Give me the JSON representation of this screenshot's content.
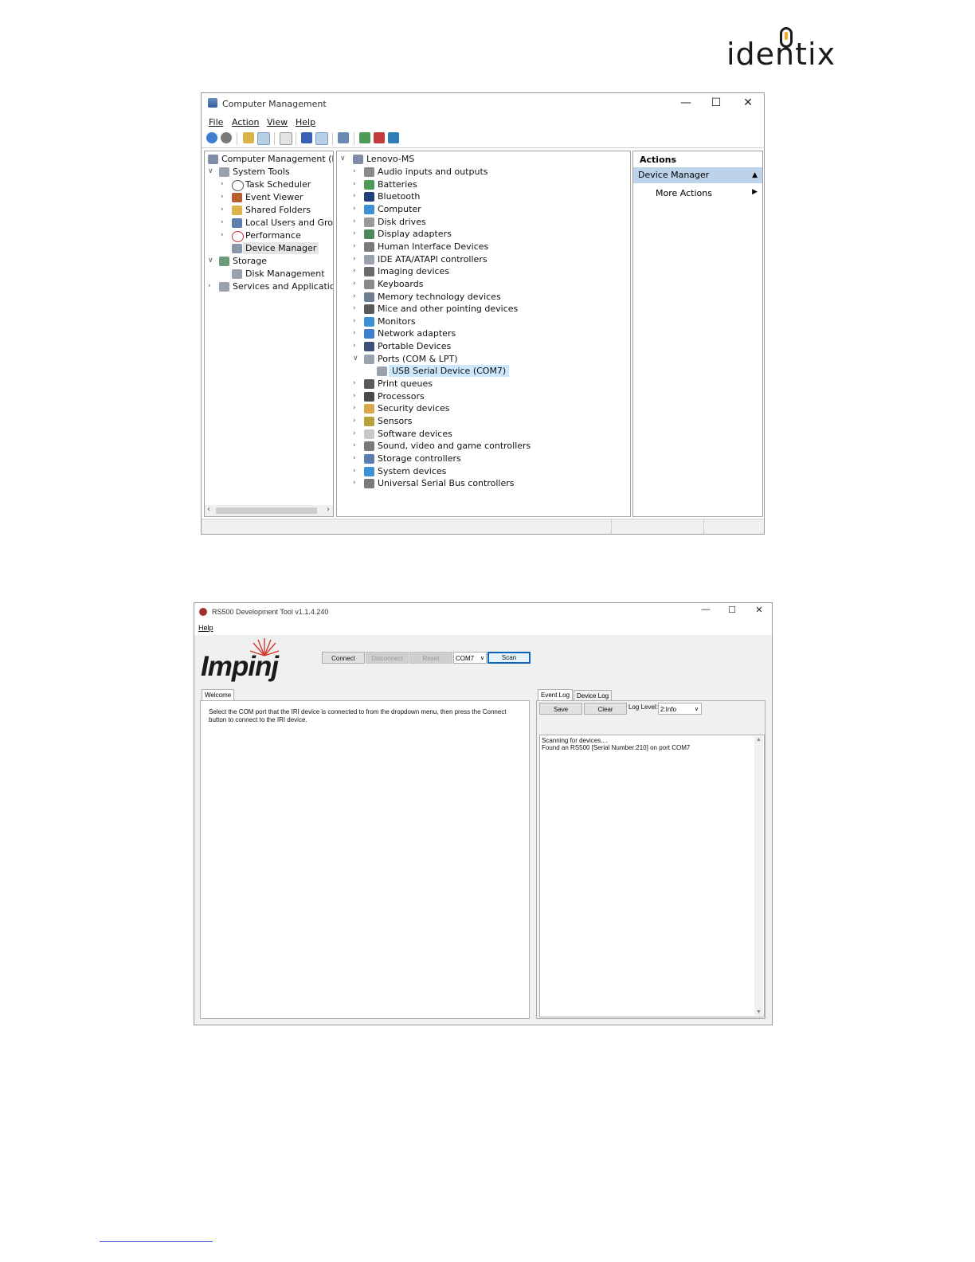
{
  "brand": {
    "logo_text": "identix"
  },
  "computer_management": {
    "title": "Computer Management",
    "window_controls": {
      "minimize": "—",
      "maximize": "☐",
      "close": "✕"
    },
    "menu": [
      "File",
      "Action",
      "View",
      "Help"
    ],
    "left_tree": [
      {
        "label": "Computer Management (Local",
        "level": 0,
        "chevron": ""
      },
      {
        "label": "System Tools",
        "level": 1,
        "chevron": "v"
      },
      {
        "label": "Task Scheduler",
        "level": 2,
        "chevron": ">"
      },
      {
        "label": "Event Viewer",
        "level": 2,
        "chevron": ">"
      },
      {
        "label": "Shared Folders",
        "level": 2,
        "chevron": ">"
      },
      {
        "label": "Local Users and Groups",
        "level": 2,
        "chevron": ">"
      },
      {
        "label": "Performance",
        "level": 2,
        "chevron": ">"
      },
      {
        "label": "Device Manager",
        "level": 2,
        "chevron": "",
        "selected": true
      },
      {
        "label": "Storage",
        "level": 1,
        "chevron": "v"
      },
      {
        "label": "Disk Management",
        "level": 2,
        "chevron": ""
      },
      {
        "label": "Services and Applications",
        "level": 1,
        "chevron": ">"
      }
    ],
    "device_root": "Lenovo-MS",
    "devices": [
      "Audio inputs and outputs",
      "Batteries",
      "Bluetooth",
      "Computer",
      "Disk drives",
      "Display adapters",
      "Human Interface Devices",
      "IDE ATA/ATAPI controllers",
      "Imaging devices",
      "Keyboards",
      "Memory technology devices",
      "Mice and other pointing devices",
      "Monitors",
      "Network adapters",
      "Portable Devices",
      "Ports (COM & LPT)",
      "USB Serial Device (COM7)",
      "Print queues",
      "Processors",
      "Security devices",
      "Sensors",
      "Software devices",
      "Sound, video and game controllers",
      "Storage controllers",
      "System devices",
      "Universal Serial Bus controllers"
    ],
    "actions": {
      "header": "Actions",
      "section": "Device Manager",
      "more": "More Actions"
    },
    "colors": {
      "selection": "#cce8ff",
      "actions_section": "#bcd3ea"
    }
  },
  "rs500": {
    "title": "RS500 Development Tool v1.1.4.240",
    "window_controls": {
      "minimize": "—",
      "maximize": "☐",
      "close": "✕"
    },
    "menu": [
      "Help"
    ],
    "logo_text": "Impinj",
    "buttons": {
      "connect": "Connect",
      "disconnect": "Disconnect",
      "reset": "Reset",
      "scan": "Scan"
    },
    "port_select": {
      "value": "COM7"
    },
    "welcome_tab": "Welcome",
    "welcome_text": [
      "Select the COM port that the IRI device is connected to from the dropdown menu, then press the Connect",
      "button to connect to the IRI device."
    ],
    "log_tabs": [
      "Event Log",
      "Device Log"
    ],
    "save_label": "Save",
    "clear_label": "Clear",
    "log_level_label": "Log Level:",
    "log_level_value": "2:Info",
    "event_log": [
      "Scanning for devices....",
      "Found an RS500 [Serial Number:210] on port COM7"
    ],
    "colors": {
      "focus_border": "#0a64b8"
    }
  }
}
